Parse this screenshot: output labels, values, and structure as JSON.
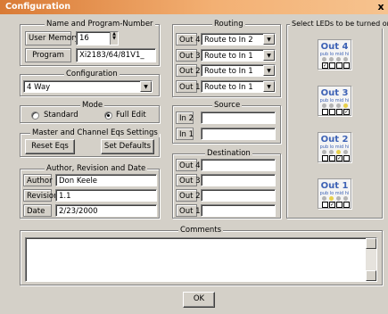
{
  "window": {
    "title": "Configuration",
    "close_glyph": "x"
  },
  "name_program": {
    "legend": "Name and Program-Number",
    "user_memory_label": "User Memory",
    "user_memory_value": "16",
    "program_label": "Program",
    "program_value": "Xi2183/64/81V1_"
  },
  "configuration": {
    "legend": "Configuration",
    "value": "4 Way"
  },
  "mode": {
    "legend": "Mode",
    "standard_label": "Standard",
    "full_edit_label": "Full Edit",
    "selected": "Full Edit"
  },
  "eqs": {
    "legend": "Master and Channel Eqs Settings",
    "reset_label": "Reset Eqs",
    "defaults_label": "Set Defaults"
  },
  "author": {
    "legend": "Author, Revision and Date",
    "rows": [
      {
        "label": "Author",
        "value": "Don Keele"
      },
      {
        "label": "Revision",
        "value": "1.1"
      },
      {
        "label": "Date",
        "value": "2/23/2000"
      }
    ]
  },
  "routing": {
    "legend": "Routing",
    "rows": [
      {
        "label": "Out 4",
        "value": "Route to In 2"
      },
      {
        "label": "Out 3",
        "value": "Route to In 1"
      },
      {
        "label": "Out 2",
        "value": "Route to In 1"
      },
      {
        "label": "Out 1",
        "value": "Route to In 1"
      }
    ]
  },
  "source": {
    "legend": "Source",
    "rows": [
      {
        "label": "In 2",
        "value": ""
      },
      {
        "label": "In 1",
        "value": ""
      }
    ]
  },
  "destination": {
    "legend": "Destination",
    "rows": [
      {
        "label": "Out 4",
        "value": ""
      },
      {
        "label": "Out 3",
        "value": ""
      },
      {
        "label": "Out 2",
        "value": ""
      },
      {
        "label": "Out 1",
        "value": ""
      }
    ]
  },
  "leds": {
    "legend": "Select LEDs to be turned on",
    "sub_label": "pub lo mid hi",
    "outputs": [
      {
        "name": "Out 4",
        "lit": [
          false,
          false,
          false,
          false
        ],
        "checked": [
          true,
          false,
          false,
          false
        ]
      },
      {
        "name": "Out 3",
        "lit": [
          false,
          false,
          false,
          true
        ],
        "checked": [
          false,
          false,
          false,
          true
        ]
      },
      {
        "name": "Out 2",
        "lit": [
          false,
          false,
          true,
          false
        ],
        "checked": [
          false,
          false,
          true,
          false
        ]
      },
      {
        "name": "Out 1",
        "lit": [
          false,
          true,
          false,
          false
        ],
        "checked": [
          false,
          true,
          false,
          false
        ]
      }
    ]
  },
  "comments": {
    "legend": "Comments",
    "value": ""
  },
  "ok_label": "OK",
  "colors": {
    "title_start": "#d97a35",
    "title_end": "#f6c38f",
    "led_text": "#3d62b5",
    "led_lit": "#e7d04a",
    "face": "#d4d0c8"
  },
  "icons": [
    "close-icon",
    "chevron-down-icon",
    "spin-updown-icon",
    "scroll-up-icon",
    "scroll-down-icon"
  ]
}
